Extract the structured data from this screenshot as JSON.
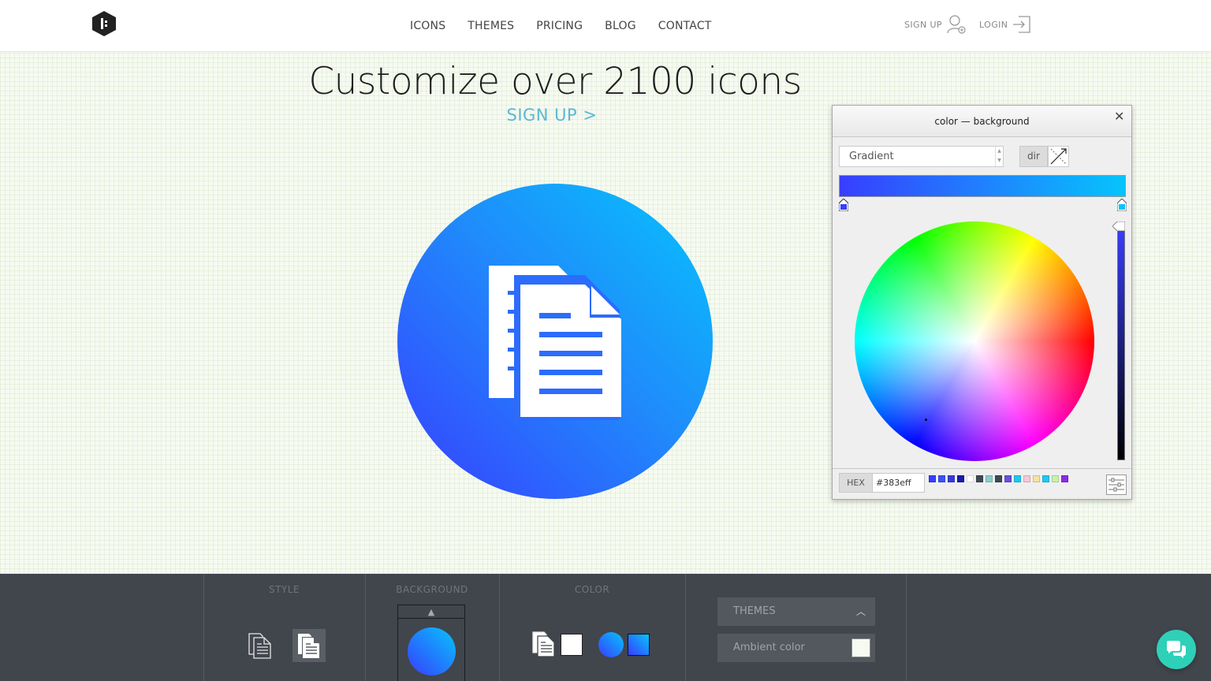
{
  "nav": {
    "items": [
      "ICONS",
      "THEMES",
      "PRICING",
      "BLOG",
      "CONTACT"
    ],
    "signup": "SIGN UP",
    "login": "LOGIN"
  },
  "hero": {
    "title": "Customize over 2100 icons",
    "signup": "SIGN UP >"
  },
  "picker": {
    "title": "color — background",
    "close": "✕",
    "mode": "Gradient",
    "dir_label": "dir",
    "hex_label": "HEX",
    "hex_value": "#383eff",
    "gradient_start": "#383eff",
    "gradient_end": "#06c4fc",
    "swatches": [
      "#383eff",
      "#3b52f5",
      "#3a3ad8",
      "#1a1aa8",
      "#ffffff",
      "#3c4a55",
      "#89cfcf",
      "#3c4a55",
      "#6a4fd8",
      "#1ec8f0",
      "#f7c6d8",
      "#f5e1a0",
      "#1ec8f0",
      "#c9f0b0",
      "#8a2be2"
    ]
  },
  "toolbar": {
    "style_label": "STYLE",
    "background_label": "BACKGROUND",
    "color_label": "COLOR",
    "themes_label": "THEMES",
    "ambient_label": "Ambient color",
    "ambient_color": "#f6faf1"
  },
  "icons": {
    "logo": "logo-icon",
    "signup": "user-add-icon",
    "login": "login-icon",
    "document": "documents-icon",
    "chat": "chat-icon",
    "settings": "sliders-icon"
  }
}
